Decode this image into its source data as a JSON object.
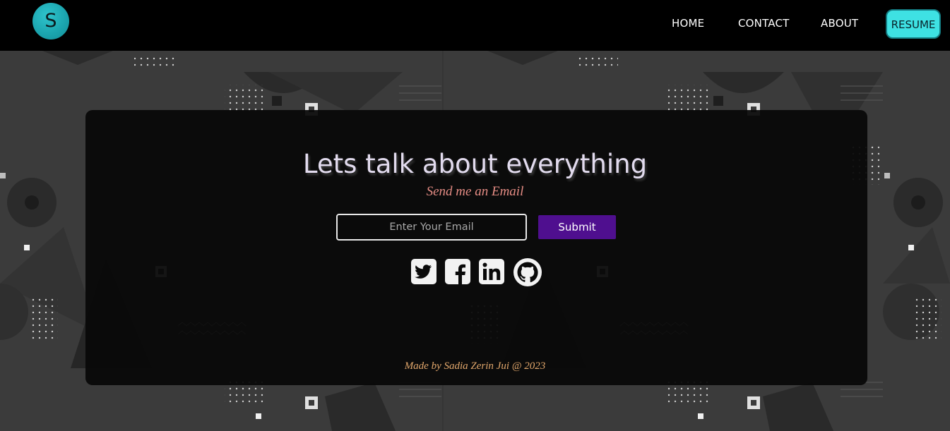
{
  "navbar": {
    "logo_letter": "S",
    "links": [
      {
        "label": "HOME"
      },
      {
        "label": "CONTACT"
      },
      {
        "label": "ABOUT"
      }
    ],
    "resume_label": "RESUME",
    "accent_color": "#3ee1e3"
  },
  "contact": {
    "heading": "Lets talk about everything",
    "subheading": "Send me an Email",
    "email_placeholder": "Enter Your Email",
    "email_value": "",
    "submit_label": "Submit",
    "submit_color": "#4f0f8f"
  },
  "social_icons": [
    "twitter-icon",
    "facebook-icon",
    "linkedin-icon",
    "github-icon"
  ],
  "footer": {
    "text": "Made by Sadia Zerin Jui @ 2023"
  }
}
